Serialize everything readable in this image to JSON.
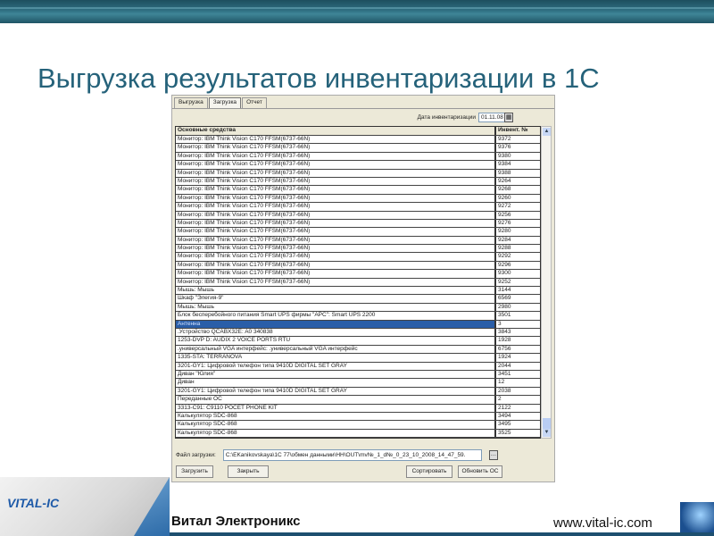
{
  "slide_title": "Выгрузка результатов инвентаризации в 1С",
  "tabs": [
    "Выгрузка",
    "Загрузка",
    "Отчет"
  ],
  "active_tab": 1,
  "date_label": "Дата инвентаризации",
  "date_value": "01.11.08",
  "table": {
    "headers": [
      "Основные средства",
      "Инвент. №"
    ],
    "rows": [
      [
        "Монитор: IBM Think Vision C170 FFSM(6737-66N)",
        "9372"
      ],
      [
        "Монитор: IBM Think Vision C170 FFSM(6737-66N)",
        "9376"
      ],
      [
        "Монитор: IBM Think Vision C170 FFSM(6737-66N)",
        "9380"
      ],
      [
        "Монитор: IBM Think Vision C170 FFSM(6737-66N)",
        "9384"
      ],
      [
        "Монитор: IBM Think Vision C170 FFSM(6737-66N)",
        "9388"
      ],
      [
        "Монитор: IBM Think Vision C170 FFSM(6737-66N)",
        "9264"
      ],
      [
        "Монитор: IBM Think Vision C170 FFSM(6737-66N)",
        "9268"
      ],
      [
        "Монитор: IBM Think Vision C170 FFSM(6737-66N)",
        "9260"
      ],
      [
        "Монитор: IBM Think Vision C170 FFSM(6737-66N)",
        "9272"
      ],
      [
        "Монитор: IBM Think Vision C170 FFSM(6737-66N)",
        "9256"
      ],
      [
        "Монитор: IBM Think Vision C170 FFSM(6737-66N)",
        "9276"
      ],
      [
        "Монитор: IBM Think Vision C170 FFSM(6737-66N)",
        "9280"
      ],
      [
        "Монитор: IBM Think Vision C170 FFSM(6737-66N)",
        "9284"
      ],
      [
        "Монитор: IBM Think Vision C170 FFSM(6737-66N)",
        "9288"
      ],
      [
        "Монитор: IBM Think Vision C170 FFSM(6737-66N)",
        "9292"
      ],
      [
        "Монитор: IBM Think Vision C170 FFSM(6737-66N)",
        "9296"
      ],
      [
        "Монитор: IBM Think Vision C170 FFSM(6737-66N)",
        "9300"
      ],
      [
        "Монитор: IBM Think Vision C170 FFSM(6737-66N)",
        "9252"
      ],
      [
        "Мышь: Мышь",
        "3144"
      ],
      [
        "Шкаф \"Элегия-9\"",
        "6569"
      ],
      [
        "Мышь: Мышь",
        "2980"
      ],
      [
        "Блок бесперебойного питания Smart UPS фирмы \"APC\": Smart UPS 2200",
        "3501"
      ],
      [
        "Антенна",
        "3"
      ],
      [
        ".Устройство QCABX32E: A0 340838",
        "3843"
      ],
      [
        "1253-DVP D: AUDIX 2 VOICE PORTS RTU",
        "1928"
      ],
      [
        ".универсальный VGA интерфейс: .универсальный VGA интерфейс",
        "6756"
      ],
      [
        "1335-STA: TERRANOVA",
        "1924"
      ],
      [
        "3201-GY1: Цифровой телефон типа 9410D DIGITAL SET GRAY",
        "2044"
      ],
      [
        "Диван \"Юлия\"",
        "3451"
      ],
      [
        "Диван",
        "12"
      ],
      [
        "3201-GY1: Цифровой телефон типа 9410D DIGITAL SET GRAY",
        "2038"
      ],
      [
        "Переданные ОС",
        "2"
      ],
      [
        "3313-C91: C9110 POCET PHONE KIT",
        "2122"
      ],
      [
        "Калькулятор SDC-868",
        "3494"
      ],
      [
        "Калькулятор SDC-868",
        "3495"
      ],
      [
        "Калькулятор SDC-868",
        "3525"
      ]
    ],
    "selected_row": 22
  },
  "file_label": "Файл загрузки:",
  "file_value": "C:\\EKanikovskaya\\1С 77\\обмен данными\\HH\\OUT\\mv№_1_d№_0_23_10_2008_14_47_59.",
  "buttons": {
    "load": "Загрузить",
    "close": "Закрыть",
    "sort": "Сортировать",
    "update": "Обновить ОС"
  },
  "footer": {
    "logo": "VITAL-IC",
    "company": "Витал Электроникс",
    "url": "www.vital-ic.com"
  }
}
